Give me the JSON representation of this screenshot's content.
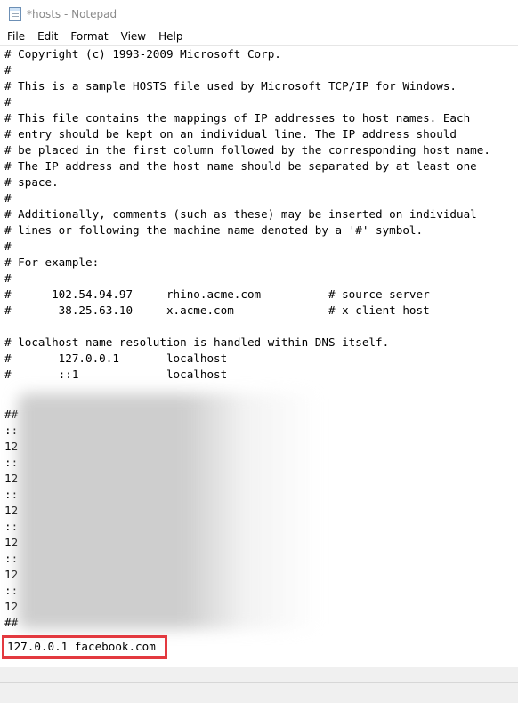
{
  "window": {
    "title": "*hosts - Notepad"
  },
  "menu": {
    "file": "File",
    "edit": "Edit",
    "format": "Format",
    "view": "View",
    "help": "Help"
  },
  "editor": {
    "lines": [
      "# Copyright (c) 1993-2009 Microsoft Corp.",
      "#",
      "# This is a sample HOSTS file used by Microsoft TCP/IP for Windows.",
      "#",
      "# This file contains the mappings of IP addresses to host names. Each",
      "# entry should be kept on an individual line. The IP address should",
      "# be placed in the first column followed by the corresponding host name.",
      "# The IP address and the host name should be separated by at least one",
      "# space.",
      "#",
      "# Additionally, comments (such as these) may be inserted on individual",
      "# lines or following the machine name denoted by a '#' symbol.",
      "#",
      "# For example:",
      "#",
      "#      102.54.94.97     rhino.acme.com          # source server",
      "#       38.25.63.10     x.acme.com              # x client host",
      "",
      "# localhost name resolution is handled within DNS itself.",
      "#       127.0.0.1       localhost",
      "#       ::1             localhost"
    ],
    "obscured_fragments": [
      "##",
      "::",
      "12",
      "::",
      "12",
      "::",
      "12",
      "::",
      "12",
      "::",
      "12",
      "::",
      "12",
      "##"
    ],
    "highlighted_line": "127.0.0.1 facebook.com"
  },
  "colors": {
    "highlight_border": "#e3393f"
  }
}
